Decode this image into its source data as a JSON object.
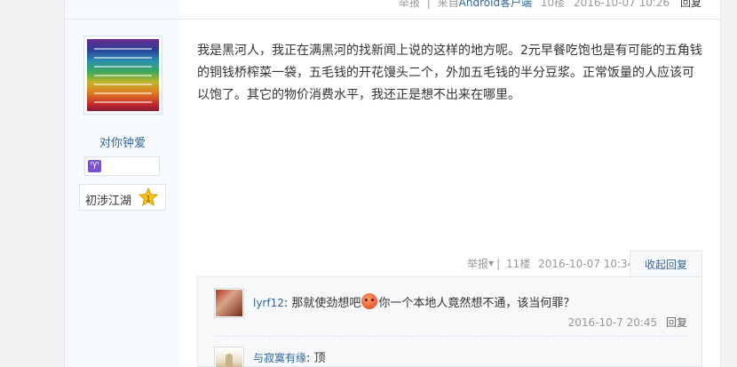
{
  "prev_post": {
    "report_label": "举报",
    "source_prefix": "来自",
    "source_link": "Android客户端",
    "floor": "10楼",
    "timestamp": "2016-10-07 10:26",
    "reply_label": "回复"
  },
  "user": {
    "username": "对你钟爱",
    "zodiac_icon": "aries-icon",
    "zodiac_glyph": "♈",
    "rank": "初涉江湖",
    "level": "1"
  },
  "post": {
    "content": "我是黑河人，我正在满黑河的找新闻上说的这样的地方呢。2元早餐吃饱也是有可能的五角钱的铜钱桥榨菜一袋，五毛钱的开花馒头二个，外加五毛钱的半分豆浆。正常饭量的人应该可以饱了。其它的物价消费水平，我还正是想不出来在哪里。",
    "report_label": "举报",
    "separator": "|",
    "floor": "11楼",
    "timestamp": "2016-10-07 10:34",
    "fold_label": "收起回复"
  },
  "replies": [
    {
      "username": "lyrf12",
      "colon": ":",
      "text_before": " 那就使劲想吧",
      "emoji": "angry-face-emoji",
      "text_after": "你一个本地人竟然想不通，该当何罪？",
      "timestamp": "2016-10-7 20:45",
      "reply_label": "回复"
    },
    {
      "username": "与寂寞有缘",
      "colon": ":",
      "text": " 顶"
    }
  ],
  "colors": {
    "link": "#336699",
    "sidebar_bg": "#f7fbff",
    "panel_bg": "#f7f8fa",
    "meta_gray": "#999999"
  }
}
